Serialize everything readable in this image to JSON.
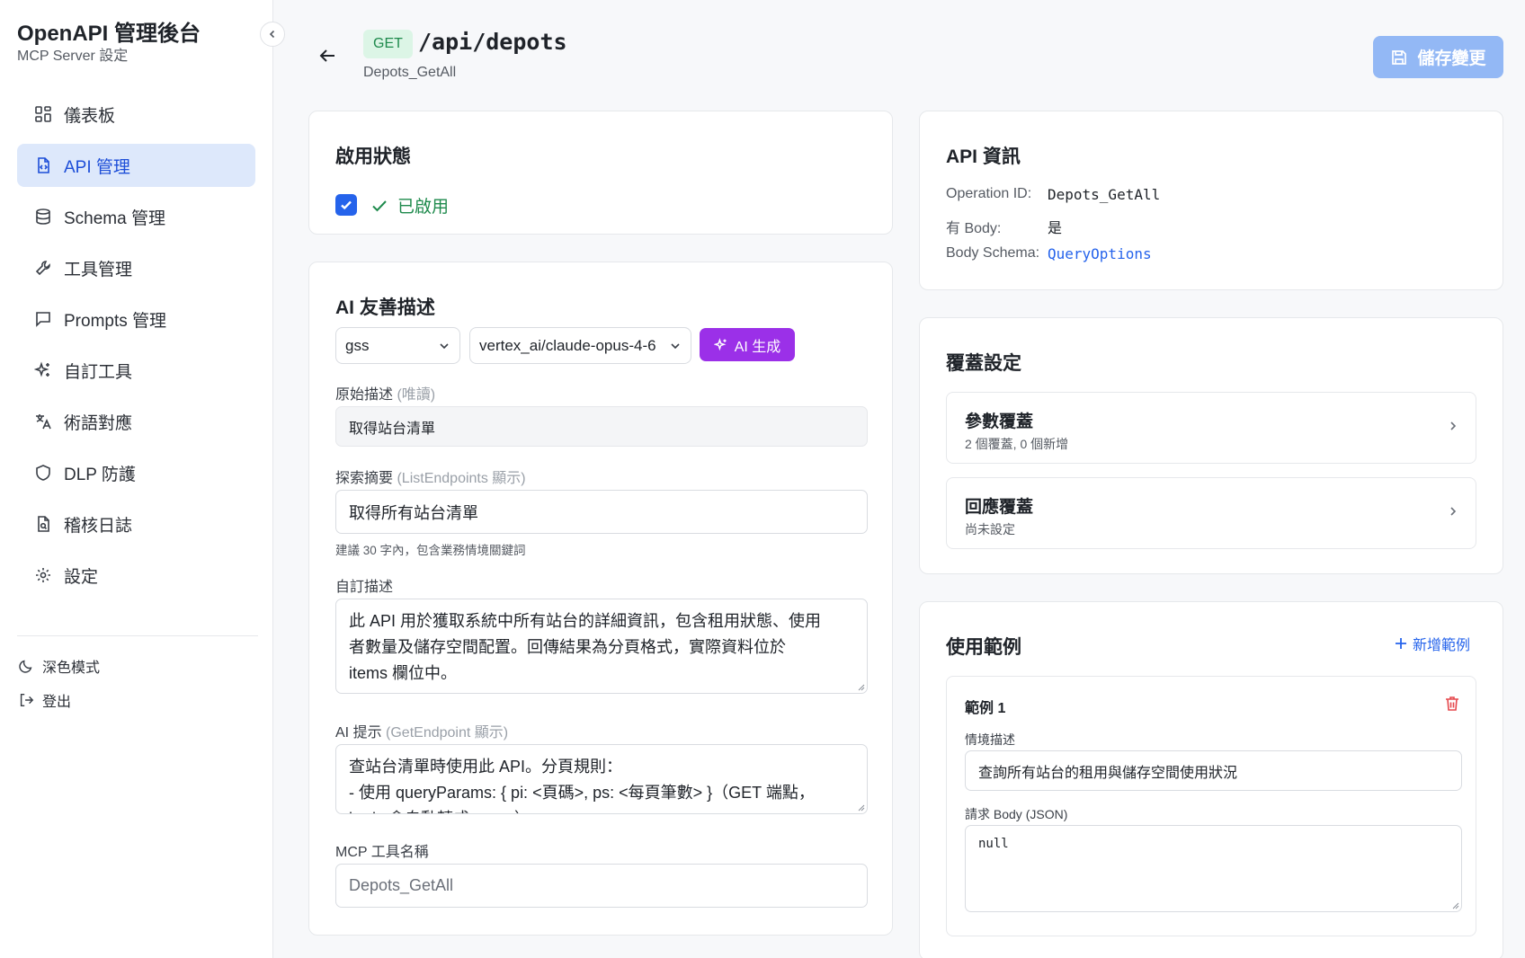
{
  "sidebar": {
    "title": "OpenAPI 管理後台",
    "subtitle": "MCP Server 設定",
    "items": [
      {
        "label": "儀表板",
        "icon": "dashboard-icon"
      },
      {
        "label": "API 管理",
        "icon": "file-code-icon",
        "active": true
      },
      {
        "label": "Schema 管理",
        "icon": "database-icon"
      },
      {
        "label": "工具管理",
        "icon": "wrench-icon"
      },
      {
        "label": "Prompts 管理",
        "icon": "message-square-icon"
      },
      {
        "label": "自訂工具",
        "icon": "sparkles-icon"
      },
      {
        "label": "術語對應",
        "icon": "languages-icon"
      },
      {
        "label": "DLP 防護",
        "icon": "shield-icon"
      },
      {
        "label": "稽核日誌",
        "icon": "file-search-icon"
      },
      {
        "label": "設定",
        "icon": "gear-icon"
      }
    ],
    "dark_mode_label": "深色模式",
    "logout_label": "登出"
  },
  "header": {
    "method": "GET",
    "path": "/api/depots",
    "operation": "Depots_GetAll",
    "save_label": "儲存變更"
  },
  "status_card": {
    "title": "啟用狀態",
    "enabled_label": "已啟用",
    "checked": true
  },
  "ai_card": {
    "title": "AI 友善描述",
    "provider": "gss",
    "model": "vertex_ai/claude-opus-4-6",
    "generate_label": "AI 生成",
    "original_label": "原始描述",
    "original_note": "(唯讀)",
    "original_value": "取得站台清單",
    "summary_label": "探索摘要",
    "summary_note": "(ListEndpoints 顯示)",
    "summary_value": "取得所有站台清單",
    "summary_hint": "建議 30 字內，包含業務情境關鍵詞",
    "custom_label": "自訂描述",
    "custom_lines": [
      "此 API 用於獲取系統中所有站台的詳細資訊，包含租用狀態、使用",
      "者數量及儲存空間配置。回傳結果為分頁格式，實際資料位於",
      "items 欄位中。"
    ],
    "hint_label": "AI 提示",
    "hint_note": "(GetEndpoint 顯示)",
    "hint_lines": [
      "查站台清單時使用此 API。分頁規則：",
      "- 使用 queryParams: { pi: <頁碼>, ps: <每頁筆數> }（GET 端點，",
      "body 會自動轉成 query）"
    ],
    "tool_label": "MCP 工具名稱",
    "tool_placeholder": "Depots_GetAll"
  },
  "api_info": {
    "title": "API 資訊",
    "operation_id_label": "Operation ID:",
    "operation_id": "Depots_GetAll",
    "has_body_label": "有 Body:",
    "has_body": "是",
    "body_schema_label": "Body Schema:",
    "body_schema": "QueryOptions"
  },
  "override": {
    "title": "覆蓋設定",
    "param_title": "參數覆蓋",
    "param_sub": "2 個覆蓋, 0 個新增",
    "response_title": "回應覆蓋",
    "response_sub": "尚未設定"
  },
  "examples": {
    "title": "使用範例",
    "add_label": "新增範例",
    "item_title": "範例 1",
    "scenario_label": "情境描述",
    "scenario_value": "查詢所有站台的租用與儲存空間使用狀況",
    "body_label": "請求 Body (JSON)",
    "body_value": "null"
  },
  "colors": {
    "primary": "#2563eb",
    "active_bg": "#dde8fb",
    "ai_purple": "#9b30e8",
    "success": "#1e8a4c",
    "danger": "#e5484d"
  }
}
